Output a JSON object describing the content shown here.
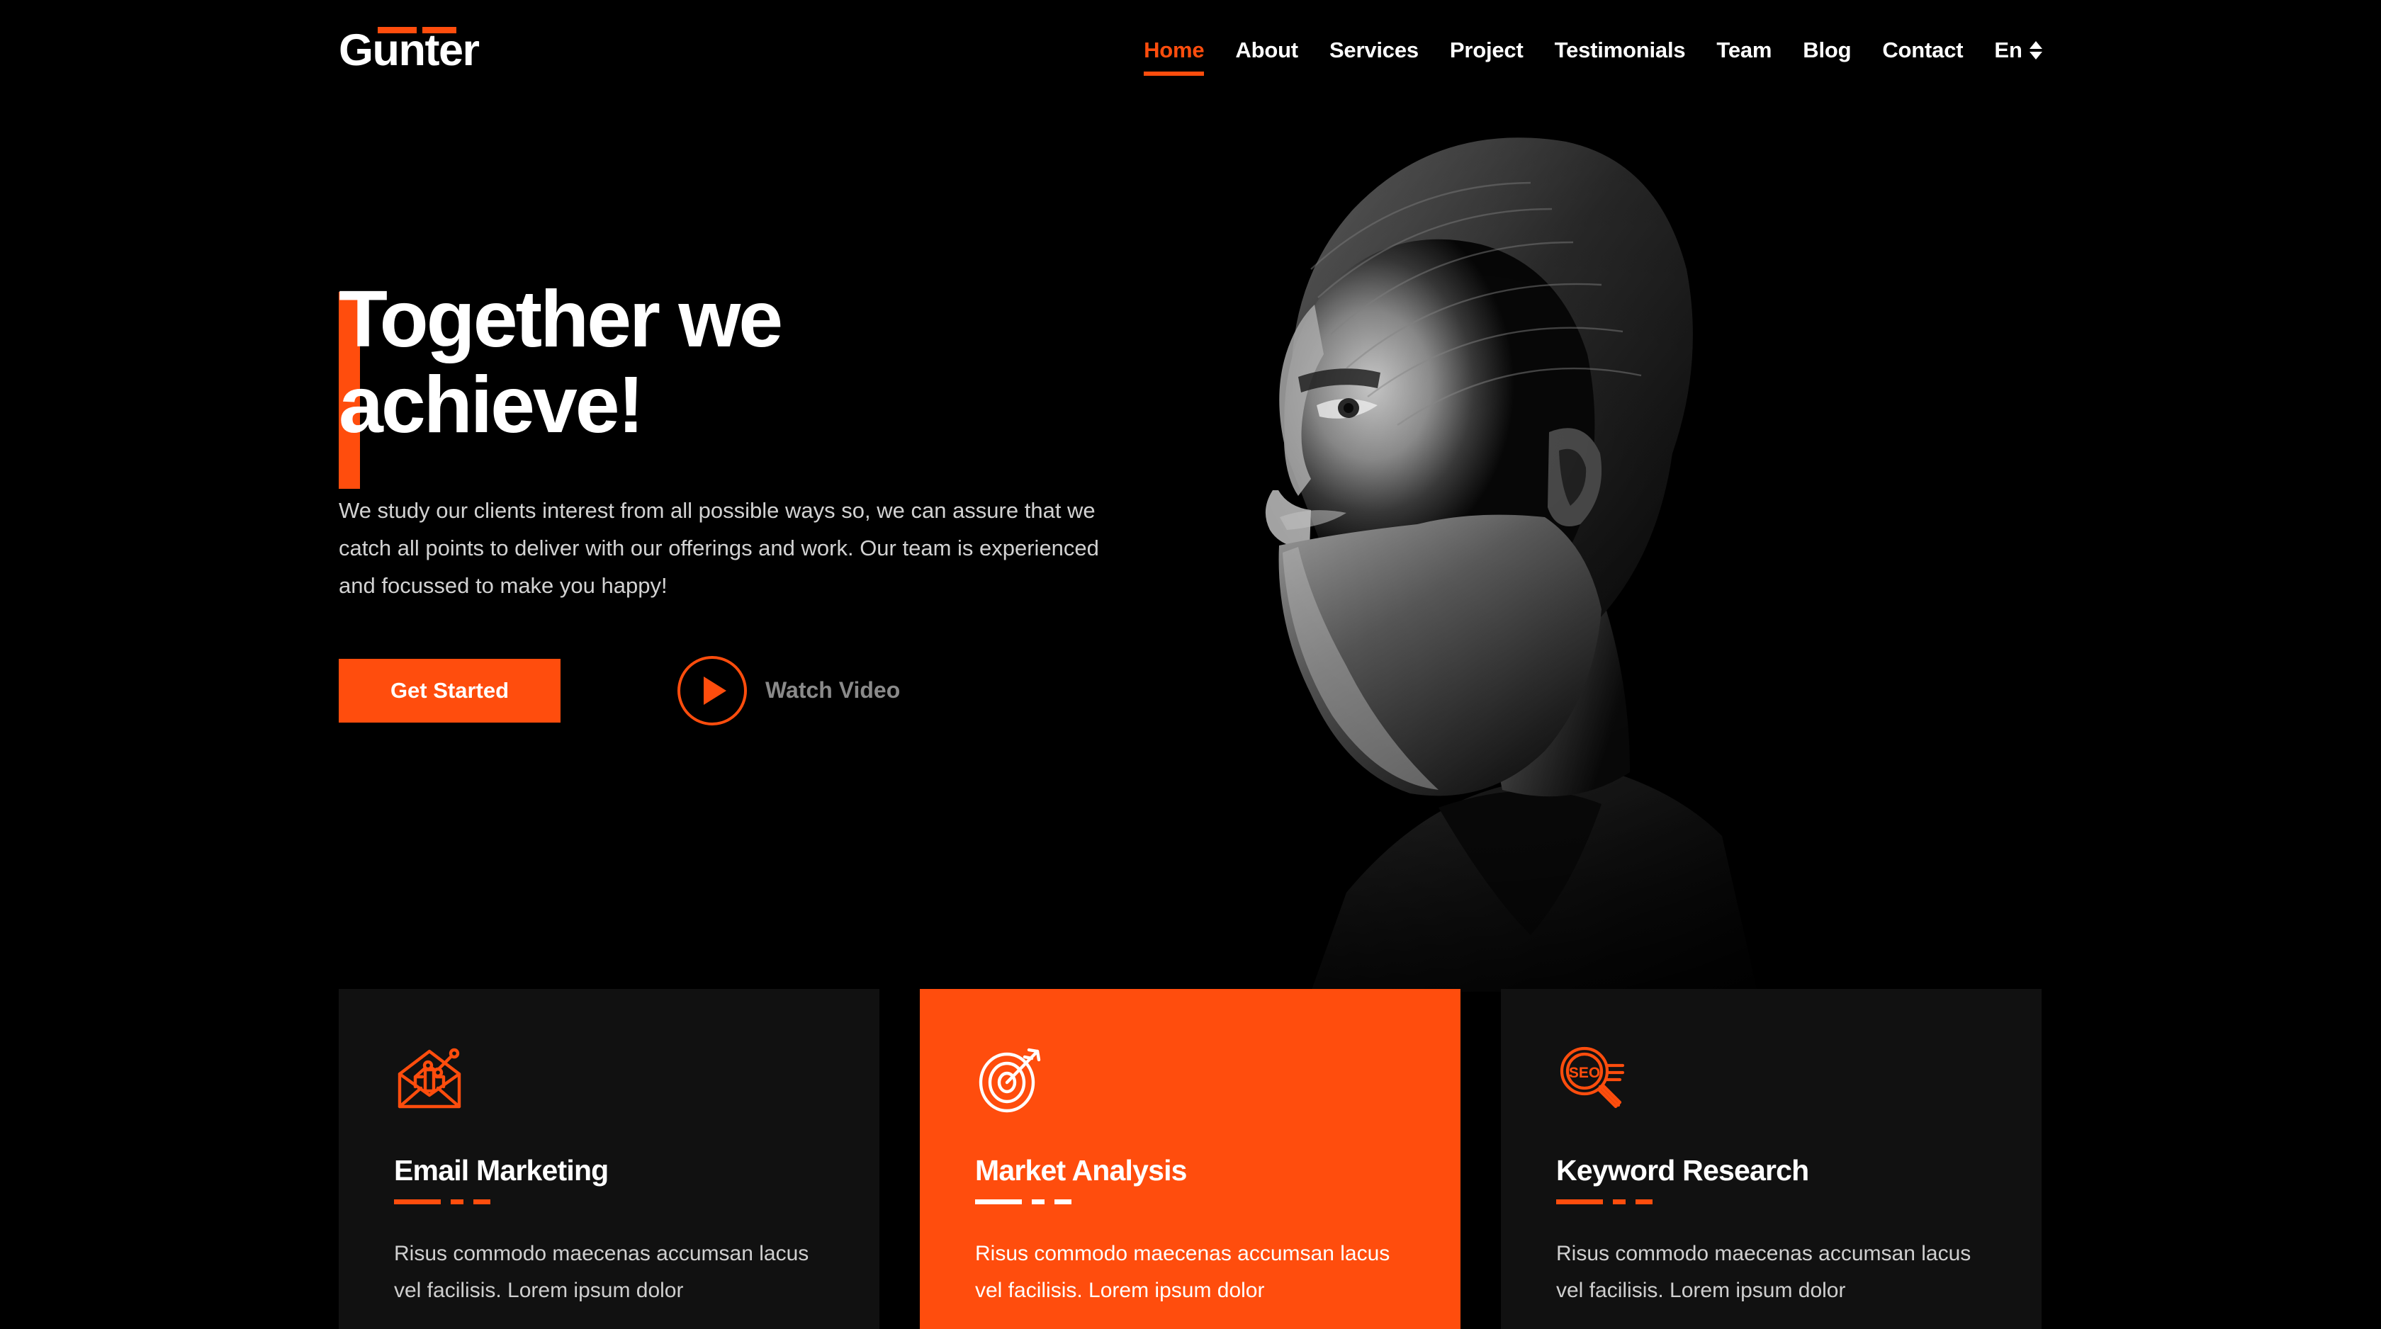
{
  "brand": {
    "name": "Gunter",
    "accent_color": "#ff4d0d"
  },
  "nav": {
    "items": [
      {
        "label": "Home",
        "active": true
      },
      {
        "label": "About",
        "active": false
      },
      {
        "label": "Services",
        "active": false
      },
      {
        "label": "Project",
        "active": false
      },
      {
        "label": "Testimonials",
        "active": false
      },
      {
        "label": "Team",
        "active": false
      },
      {
        "label": "Blog",
        "active": false
      },
      {
        "label": "Contact",
        "active": false
      }
    ],
    "language": {
      "label": "En",
      "icon": "up-down-arrows-icon"
    }
  },
  "hero": {
    "title_line1": "Together we",
    "title_line2": "achieve!",
    "paragraph": "We study our clients interest from all possible ways so, we can assure that we catch all points to deliver with our offerings and work. Our team is experienced and focussed to make you happy!",
    "primary_button": "Get Started",
    "video_label": "Watch Video",
    "video_icon": "play-icon",
    "image_alt": "black-and-white profile portrait of a bearded man"
  },
  "services": {
    "cards": [
      {
        "title": "Email Marketing",
        "body": "Risus commodo maecenas accumsan lacus vel facilisis. Lorem ipsum dolor",
        "icon": "envelope-chart-icon",
        "highlighted": false
      },
      {
        "title": "Market Analysis",
        "body": "Risus commodo maecenas accumsan lacus vel facilisis. Lorem ipsum dolor",
        "icon": "target-arrow-icon",
        "highlighted": true
      },
      {
        "title": "Keyword Research",
        "body": "Risus commodo maecenas accumsan lacus vel facilisis. Lorem ipsum dolor",
        "icon": "seo-magnifier-icon",
        "highlighted": false
      }
    ]
  }
}
